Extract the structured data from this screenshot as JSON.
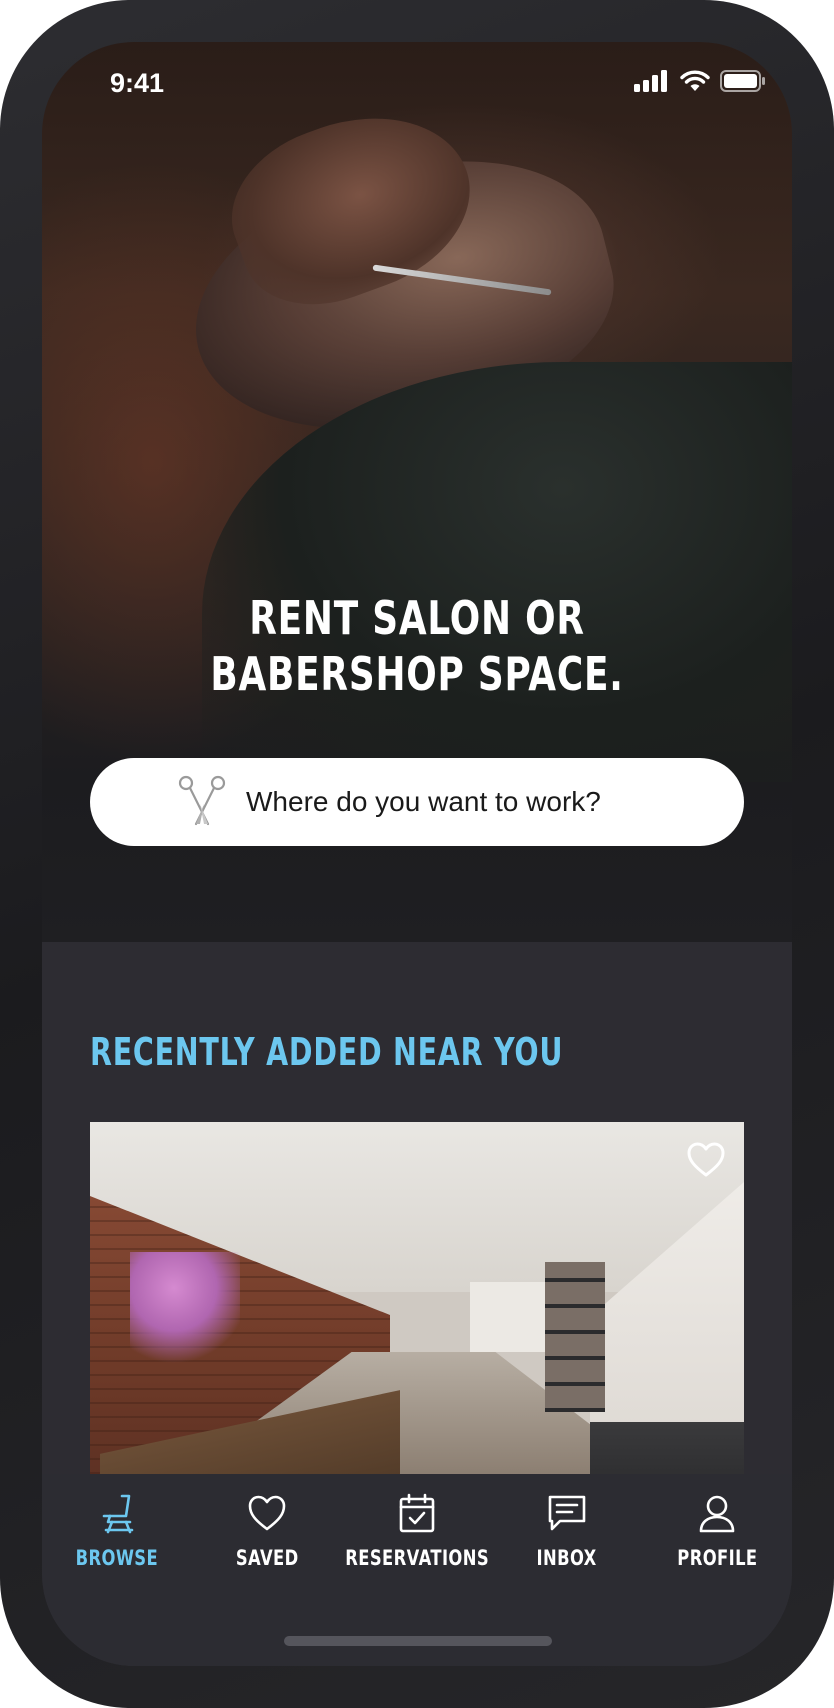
{
  "status_bar": {
    "time": "9:41",
    "icons": [
      "cellular-signal-icon",
      "wifi-icon",
      "battery-icon"
    ]
  },
  "hero": {
    "title_line1": "RENT SALON OR",
    "title_line2": "BABERSHOP SPACE.",
    "image": "barber-trimming-beard-photo"
  },
  "search": {
    "icon": "scissors-icon",
    "placeholder": "Where do you want to work?"
  },
  "recent": {
    "title": "RECENTLY ADDED NEAR YOU",
    "listings": [
      {
        "image": "brick-wall-salon-interior-photo",
        "saved_icon": "heart-outline-icon"
      }
    ]
  },
  "tabbar": {
    "tabs": [
      {
        "label": "BROWSE",
        "icon": "salon-chair-icon",
        "active": true
      },
      {
        "label": "SAVED",
        "icon": "heart-icon",
        "active": false
      },
      {
        "label": "RESERVATIONS",
        "icon": "calendar-check-icon",
        "active": false
      },
      {
        "label": "INBOX",
        "icon": "message-icon",
        "active": false
      },
      {
        "label": "PROFILE",
        "icon": "user-icon",
        "active": false
      }
    ]
  },
  "colors": {
    "accent": "#6cc7ef",
    "background": "#2d2c32",
    "tabbar": "#2c2c32",
    "text": "#ffffff"
  }
}
